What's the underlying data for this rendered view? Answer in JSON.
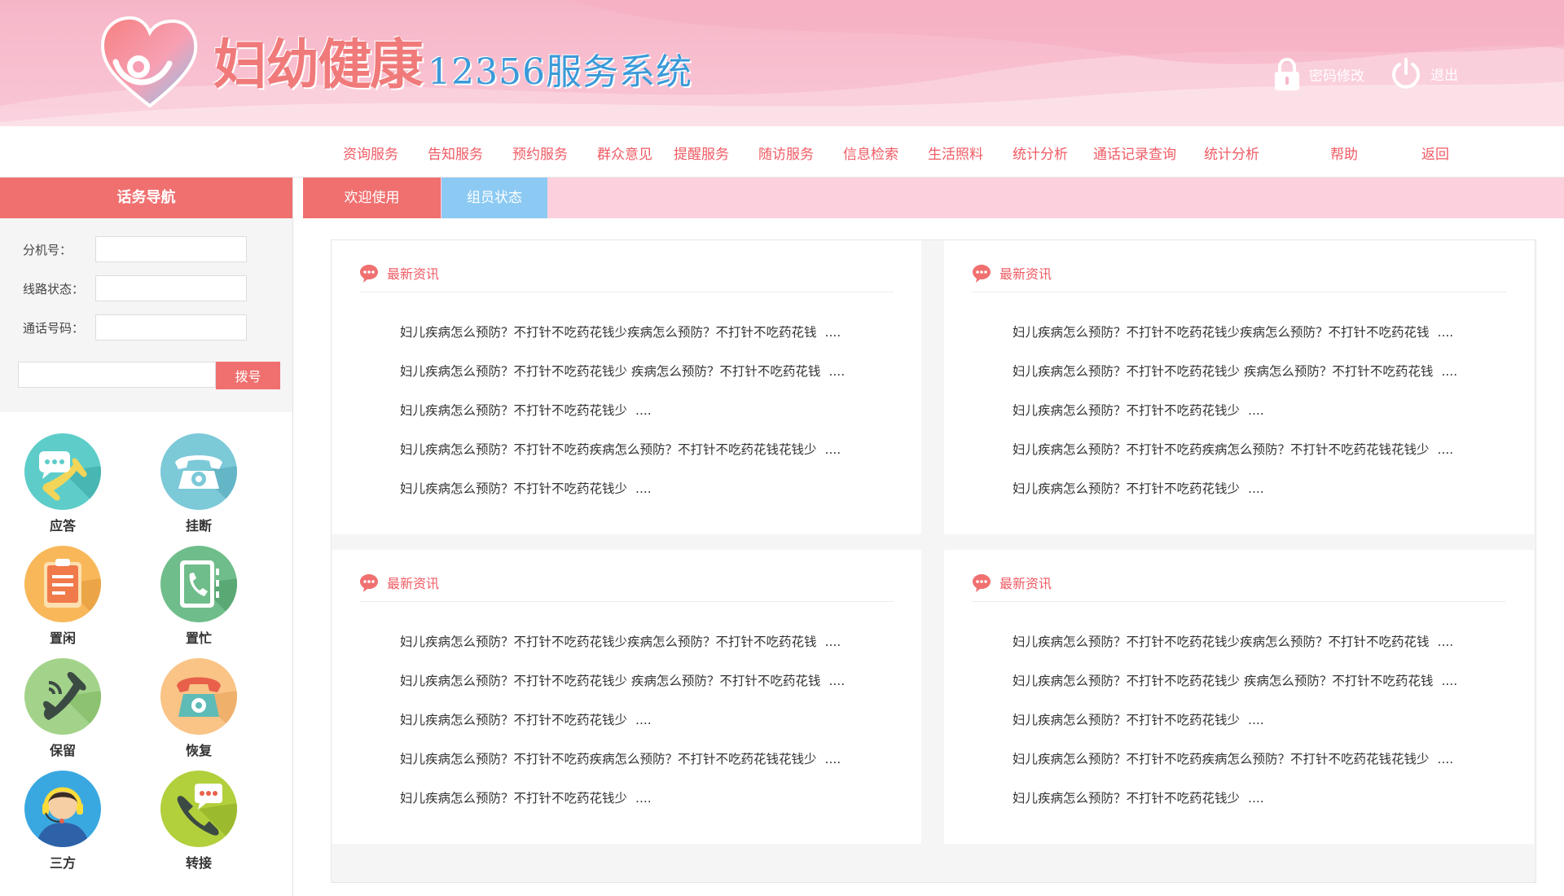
{
  "header": {
    "brand_main": "妇幼健康",
    "brand_sub": "12356服务系统",
    "password_change": "密码修改",
    "logout": "退出"
  },
  "nav": {
    "items": [
      "资询服务",
      "告知服务",
      "预约服务",
      "群众意见",
      "提醒服务",
      "随访服务",
      "信息检索",
      "生活照料",
      "统计分析",
      "通话记录查询",
      "统计分析",
      "帮助",
      "返回"
    ]
  },
  "sidebar": {
    "title": "话务导航",
    "extension_label": "分机号：",
    "line_status_label": "线路状态：",
    "call_number_label": "通话号码：",
    "dial_button": "拨号",
    "actions": [
      {
        "label": "应答",
        "icon": "answer-icon"
      },
      {
        "label": "挂断",
        "icon": "hangup-icon"
      },
      {
        "label": "置闲",
        "icon": "idle-icon"
      },
      {
        "label": "置忙",
        "icon": "busy-icon"
      },
      {
        "label": "保留",
        "icon": "hold-icon"
      },
      {
        "label": "恢复",
        "icon": "resume-icon"
      },
      {
        "label": "三方",
        "icon": "three-way-icon"
      },
      {
        "label": "转接",
        "icon": "transfer-icon"
      }
    ]
  },
  "tabs": {
    "welcome": "欢迎使用",
    "members": "组员状态"
  },
  "panels": [
    {
      "title": "最新资讯",
      "items": [
        "妇儿疾病怎么预防？不打针不吃药花钱少疾病怎么预防？不打针不吃药花钱",
        "妇儿疾病怎么预防？不打针不吃药花钱少 疾病怎么预防？不打针不吃药花钱",
        "妇儿疾病怎么预防？不打针不吃药花钱少",
        "妇儿疾病怎么预防？不打针不吃药疾病怎么预防？不打针不吃药花钱花钱少",
        "妇儿疾病怎么预防？不打针不吃药花钱少"
      ]
    },
    {
      "title": "最新资讯",
      "items": [
        "妇儿疾病怎么预防？不打针不吃药花钱少疾病怎么预防？不打针不吃药花钱",
        "妇儿疾病怎么预防？不打针不吃药花钱少 疾病怎么预防？不打针不吃药花钱",
        "妇儿疾病怎么预防？不打针不吃药花钱少",
        "妇儿疾病怎么预防？不打针不吃药疾病怎么预防？不打针不吃药花钱花钱少",
        "妇儿疾病怎么预防？不打针不吃药花钱少"
      ]
    },
    {
      "title": "最新资讯",
      "items": [
        "妇儿疾病怎么预防？不打针不吃药花钱少疾病怎么预防？不打针不吃药花钱",
        "妇儿疾病怎么预防？不打针不吃药花钱少 疾病怎么预防？不打针不吃药花钱",
        "妇儿疾病怎么预防？不打针不吃药花钱少",
        "妇儿疾病怎么预防？不打针不吃药疾病怎么预防？不打针不吃药花钱花钱少",
        "妇儿疾病怎么预防？不打针不吃药花钱少"
      ]
    },
    {
      "title": "最新资讯",
      "items": [
        "妇儿疾病怎么预防？不打针不吃药花钱少疾病怎么预防？不打针不吃药花钱",
        "妇儿疾病怎么预防？不打针不吃药花钱少 疾病怎么预防？不打针不吃药花钱",
        "妇儿疾病怎么预防？不打针不吃药花钱少",
        "妇儿疾病怎么预防？不打针不吃药疾病怎么预防？不打针不吃药花钱花钱少",
        "妇儿疾病怎么预防？不打针不吃药花钱少"
      ]
    }
  ],
  "ellipsis": "....",
  "colors": {
    "accent": "#f07070",
    "nav_text": "#ef5b64",
    "tab_blue": "#8ccaf3",
    "header_pink": "#f7bbcc"
  }
}
